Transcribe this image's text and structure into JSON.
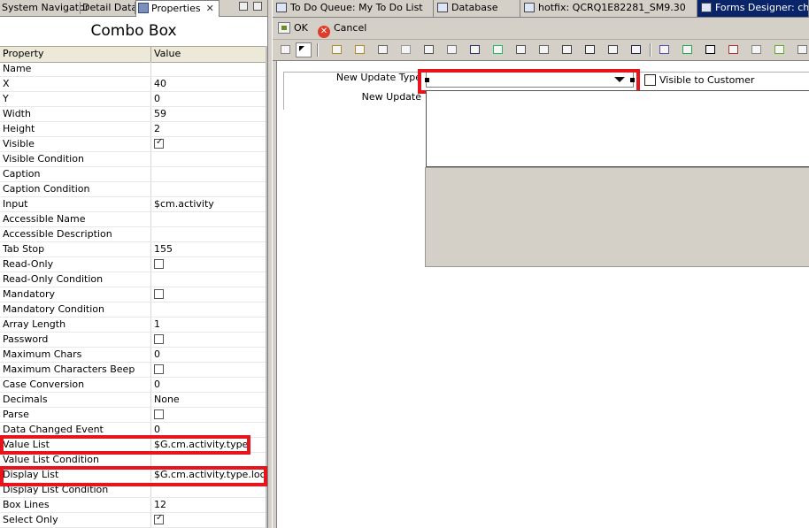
{
  "left_tabs": [
    {
      "label": "System Navigator"
    },
    {
      "label": "Detail Data"
    },
    {
      "label": "Properties"
    }
  ],
  "panel_title": "Combo Box",
  "grid_header": {
    "property": "Property",
    "value": "Value"
  },
  "properties": [
    {
      "name": "Name",
      "value": ""
    },
    {
      "name": "X",
      "value": "40"
    },
    {
      "name": "Y",
      "value": "0"
    },
    {
      "name": "Width",
      "value": "59"
    },
    {
      "name": "Height",
      "value": "2"
    },
    {
      "name": "Visible",
      "checkbox": true,
      "checked": true
    },
    {
      "name": "Visible Condition",
      "value": ""
    },
    {
      "name": "Caption",
      "value": ""
    },
    {
      "name": "Caption Condition",
      "value": ""
    },
    {
      "name": "Input",
      "value": "$cm.activity"
    },
    {
      "name": "Accessible Name",
      "value": ""
    },
    {
      "name": "Accessible Description",
      "value": ""
    },
    {
      "name": "Tab Stop",
      "value": "155"
    },
    {
      "name": "Read-Only",
      "checkbox": true,
      "checked": false
    },
    {
      "name": "Read-Only Condition",
      "value": ""
    },
    {
      "name": "Mandatory",
      "checkbox": true,
      "checked": false
    },
    {
      "name": "Mandatory Condition",
      "value": ""
    },
    {
      "name": "Array Length",
      "value": "1"
    },
    {
      "name": "Password",
      "checkbox": true,
      "checked": false
    },
    {
      "name": "Maximum Chars",
      "value": "0"
    },
    {
      "name": "Maximum Characters Beep",
      "checkbox": true,
      "checked": false
    },
    {
      "name": "Case Conversion",
      "value": "0"
    },
    {
      "name": "Decimals",
      "value": "None"
    },
    {
      "name": "Parse",
      "checkbox": true,
      "checked": false
    },
    {
      "name": "Data Changed Event",
      "value": "0"
    },
    {
      "name": "Value List",
      "value": "$G.cm.activity.type"
    },
    {
      "name": "Value List Condition",
      "value": ""
    },
    {
      "name": "Display List",
      "value": "$G.cm.activity.type.local"
    },
    {
      "name": "Display List Condition",
      "value": ""
    },
    {
      "name": "Box Lines",
      "value": "12"
    },
    {
      "name": "Select Only",
      "checkbox": true,
      "checked": true
    }
  ],
  "right_tabs": [
    {
      "label": "To Do Queue: My To Do List"
    },
    {
      "label": "Database"
    },
    {
      "label": "hotfix:  QCRQ1E82281_SM9.30"
    },
    {
      "label": "Forms Designer: chm.ac"
    }
  ],
  "actions": {
    "ok": "OK",
    "cancel": "Cancel"
  },
  "toolbar_icons": [
    "grid-icon",
    "pointer-icon",
    "frame-icon",
    "group-icon",
    "notebook-icon",
    "box-icon",
    "button-icon",
    "combo-icon",
    "checkbox-icon",
    "comfill-icon",
    "date-icon",
    "list-icon",
    "radio-icon",
    "edit-icon",
    "label-icon",
    "marquee-icon",
    "subform-icon",
    "table-icon",
    "text-icon",
    "spin-icon",
    "panel-icon",
    "tree-icon",
    "columns-icon"
  ],
  "form": {
    "new_update_type_label": "New Update Type",
    "visible_to_customer_label": "Visible to Customer",
    "new_update_label": "New Update"
  },
  "colors": {
    "highlight": "#e8141c",
    "active_tab": "#0a246a"
  }
}
